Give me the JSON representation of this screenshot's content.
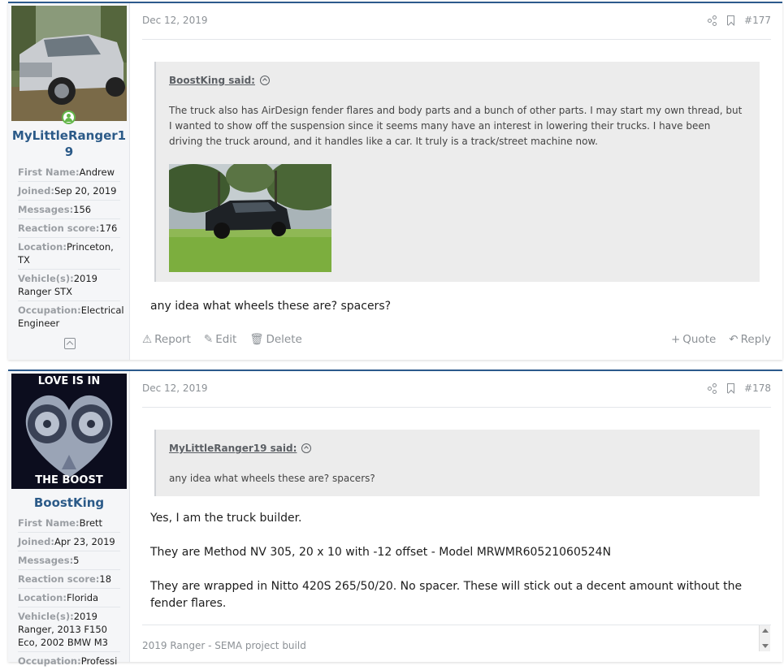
{
  "posts": [
    {
      "date": "Dec 12, 2019",
      "number": "#177",
      "user": {
        "name_line1": "MyLittleRanger1",
        "name_line2": "9",
        "fields": [
          {
            "label": "First Name:",
            "value": "Andrew"
          },
          {
            "label": "Joined:",
            "value": "Sep 20, 2019"
          },
          {
            "label": "Messages:",
            "value": "156"
          },
          {
            "label": "Reaction score:",
            "value": "176"
          },
          {
            "label": "Location:",
            "value": "Princeton, TX"
          },
          {
            "label": "Vehicle(s):",
            "value": "2019 Ranger STX"
          },
          {
            "label": "Occupation:",
            "value": "Electrical Engineer"
          }
        ]
      },
      "quote": {
        "author": "BoostKing said:",
        "text": "The truck also has AirDesign fender flares and body parts and a bunch of other parts. I may start my own thread, but I wanted to show off the suspension since it seems many have an interest in lowering their trucks. I have been driving the truck around, and it handles like a car. It truly is a track/street machine now."
      },
      "message": "any idea what wheels these are? spacers?",
      "actions": {
        "report": "Report",
        "edit": "Edit",
        "delete": "Delete",
        "quote": "Quote",
        "reply": "Reply"
      }
    },
    {
      "date": "Dec 12, 2019",
      "number": "#178",
      "user": {
        "name": "BoostKing",
        "avatar_text_top": "LOVE IS IN",
        "avatar_text_bottom": "THE BOOST",
        "fields": [
          {
            "label": "First Name:",
            "value": "Brett"
          },
          {
            "label": "Joined:",
            "value": "Apr 23, 2019"
          },
          {
            "label": "Messages:",
            "value": "5"
          },
          {
            "label": "Reaction score:",
            "value": "18"
          },
          {
            "label": "Location:",
            "value": "Florida"
          },
          {
            "label": "Vehicle(s):",
            "value": "2019 Ranger, 2013 F150 Eco, 2002 BMW M3"
          },
          {
            "label": "Occupation:",
            "value": "Professi"
          }
        ]
      },
      "quote": {
        "author": "MyLittleRanger19 said:",
        "text": "any idea what wheels these are? spacers?"
      },
      "message_lines": [
        "Yes, I am the truck builder.",
        "They are Method NV 305, 20 x 10 with -12 offset - Model MRWMR60521060524N",
        "They are wrapped in Nitto 420S 265/50/20. No spacer. These will stick out a decent amount without the fender flares."
      ],
      "signature": "2019 Ranger - SEMA project build"
    }
  ],
  "colors": {
    "accent": "#2c5a8c",
    "username": "#2b5a88",
    "online": "#63b649"
  }
}
